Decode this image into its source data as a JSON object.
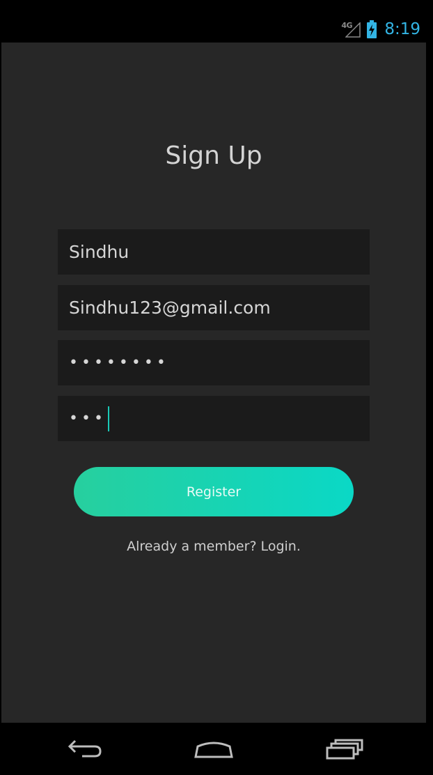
{
  "status_bar": {
    "network": "4G",
    "time": "8:19",
    "icons": [
      "signal-icon",
      "battery-charging-icon"
    ]
  },
  "screen": {
    "title": "Sign Up",
    "fields": {
      "name_value": "Sindhu",
      "email_value": "Sindhu123@gmail.com",
      "password_value": "••••••••",
      "confirm_password_value": "•••"
    },
    "register_label": "Register",
    "login_link": "Already a member? Login."
  },
  "nav_bar": {
    "icons": [
      "back-icon",
      "home-icon",
      "recent-apps-icon"
    ]
  },
  "colors": {
    "accent_start": "#27cf9e",
    "accent_end": "#0ad8c6",
    "clock": "#33b5e5",
    "background": "#272727",
    "field_bg": "#1b1b1b"
  }
}
